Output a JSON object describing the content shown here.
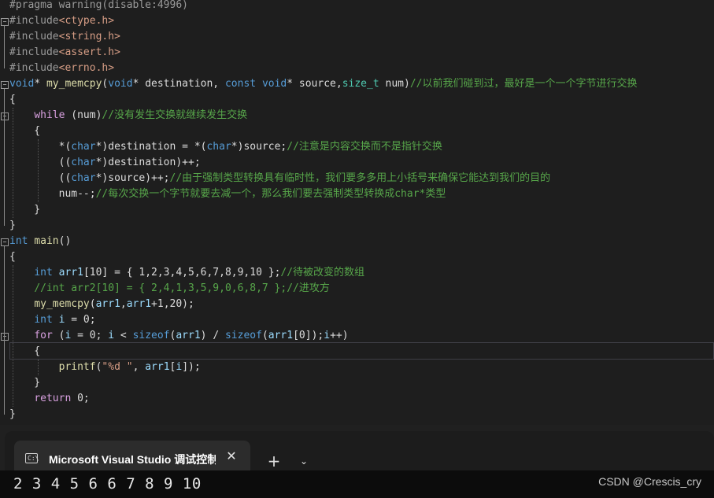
{
  "editor": {
    "lines": [
      [
        [
          "pp",
          "#pragma warning(disable:4996)"
        ]
      ],
      [
        [
          "pp",
          "#include"
        ],
        [
          "inc",
          "<ctype.h>"
        ]
      ],
      [
        [
          "pp",
          "#include"
        ],
        [
          "inc",
          "<string.h>"
        ]
      ],
      [
        [
          "pp",
          "#include"
        ],
        [
          "inc",
          "<assert.h>"
        ]
      ],
      [
        [
          "pp",
          "#include"
        ],
        [
          "inc",
          "<errno.h>"
        ]
      ],
      [
        [
          "kw",
          "void"
        ],
        [
          "pl",
          "* "
        ],
        [
          "fn",
          "my_memcpy"
        ],
        [
          "pl",
          "("
        ],
        [
          "kw",
          "void"
        ],
        [
          "pl",
          "* destination, "
        ],
        [
          "kw",
          "const"
        ],
        [
          "pl",
          " "
        ],
        [
          "kw",
          "void"
        ],
        [
          "pl",
          "* source,"
        ],
        [
          "typ",
          "size_t"
        ],
        [
          "pl",
          " num)"
        ],
        [
          "cmt",
          "//以前我们碰到过，最好是一个一个字节进行交换"
        ]
      ],
      [
        [
          "pl",
          "{"
        ]
      ],
      [
        [
          "pl",
          "    "
        ],
        [
          "ctl",
          "while"
        ],
        [
          "pl",
          " (num)"
        ],
        [
          "cmt",
          "//没有发生交换就继续发生交换"
        ]
      ],
      [
        [
          "pl",
          "    {"
        ]
      ],
      [
        [
          "pl",
          "        *("
        ],
        [
          "kw",
          "char"
        ],
        [
          "pl",
          "*)destination = *("
        ],
        [
          "kw",
          "char"
        ],
        [
          "pl",
          "*)source;"
        ],
        [
          "cmt",
          "//注意是内容交换而不是指针交换"
        ]
      ],
      [
        [
          "pl",
          "        (("
        ],
        [
          "kw",
          "char"
        ],
        [
          "pl",
          "*)destination)++;"
        ]
      ],
      [
        [
          "pl",
          "        (("
        ],
        [
          "kw",
          "char"
        ],
        [
          "pl",
          "*)source)++;"
        ],
        [
          "cmt",
          "//由于强制类型转换具有临时性，我们要多多用上小括号来确保它能达到我们的目的"
        ]
      ],
      [
        [
          "pl",
          "        num--;"
        ],
        [
          "cmt",
          "//每次交换一个字节就要去减一个，那么我们要去强制类型转换成char*类型"
        ]
      ],
      [
        [
          "pl",
          "    }"
        ]
      ],
      [
        [
          "pl",
          "}"
        ]
      ],
      [
        [
          "kw",
          "int"
        ],
        [
          "pl",
          " "
        ],
        [
          "fn",
          "main"
        ],
        [
          "pl",
          "()"
        ]
      ],
      [
        [
          "pl",
          "{"
        ]
      ],
      [
        [
          "pl",
          "    "
        ],
        [
          "kw",
          "int"
        ],
        [
          "pl",
          " "
        ],
        [
          "var",
          "arr1"
        ],
        [
          "pl",
          "[10] = { 1,2,3,4,5,6,7,8,9,10 };"
        ],
        [
          "cmt",
          "//待被改变的数组"
        ]
      ],
      [
        [
          "pl",
          "    "
        ],
        [
          "cmt",
          "//int arr2[10] = { 2,4,1,3,5,9,0,6,8,7 };//进攻方"
        ]
      ],
      [
        [
          "pl",
          "    "
        ],
        [
          "fn",
          "my_memcpy"
        ],
        [
          "pl",
          "("
        ],
        [
          "var",
          "arr1"
        ],
        [
          "pl",
          ","
        ],
        [
          "var",
          "arr1"
        ],
        [
          "pl",
          "+1,20);"
        ]
      ],
      [
        [
          "pl",
          "    "
        ],
        [
          "kw",
          "int"
        ],
        [
          "pl",
          " "
        ],
        [
          "var",
          "i"
        ],
        [
          "pl",
          " = 0;"
        ]
      ],
      [
        [
          "pl",
          "    "
        ],
        [
          "ctl",
          "for"
        ],
        [
          "pl",
          " ("
        ],
        [
          "var",
          "i"
        ],
        [
          "pl",
          " = 0; "
        ],
        [
          "var",
          "i"
        ],
        [
          "pl",
          " < "
        ],
        [
          "kw",
          "sizeof"
        ],
        [
          "pl",
          "("
        ],
        [
          "var",
          "arr1"
        ],
        [
          "pl",
          ") / "
        ],
        [
          "kw",
          "sizeof"
        ],
        [
          "pl",
          "("
        ],
        [
          "var",
          "arr1"
        ],
        [
          "pl",
          "[0]);"
        ],
        [
          "var",
          "i"
        ],
        [
          "pl",
          "++)"
        ]
      ],
      [
        [
          "pl",
          "    {"
        ]
      ],
      [
        [
          "pl",
          "        "
        ],
        [
          "fn",
          "printf"
        ],
        [
          "pl",
          "("
        ],
        [
          "str",
          "\"%d \""
        ],
        [
          "pl",
          ", "
        ],
        [
          "var",
          "arr1"
        ],
        [
          "pl",
          "["
        ],
        [
          "var",
          "i"
        ],
        [
          "pl",
          "]);"
        ]
      ],
      [
        [
          "pl",
          "    }"
        ]
      ],
      [
        [
          "pl",
          "    "
        ],
        [
          "ctl",
          "return"
        ],
        [
          "pl",
          " 0;"
        ]
      ],
      [
        [
          "pl",
          "}"
        ]
      ]
    ],
    "fold_markers": [
      "−",
      "−",
      "−",
      "−",
      "−",
      "−"
    ]
  },
  "terminal": {
    "tab_icon": "C:\\",
    "tab_title": "Microsoft Visual Studio 调试控制台",
    "close_glyph": "✕",
    "new_tab_glyph": "+",
    "dropdown_glyph": "⌄",
    "output": "2 3 4 5 6 6 7 8 9 10"
  },
  "watermark": "CSDN @Crescis_cry"
}
